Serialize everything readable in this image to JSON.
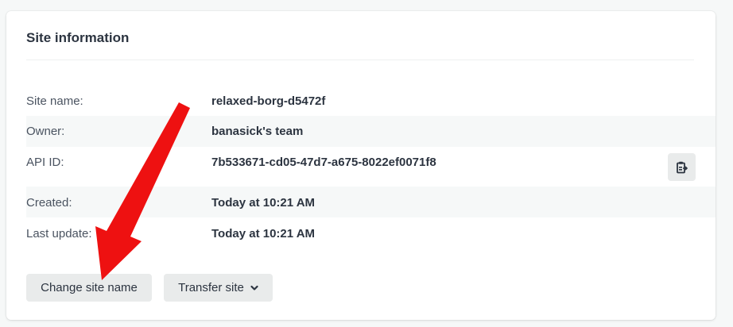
{
  "card": {
    "title": "Site information"
  },
  "rows": [
    {
      "label": "Site name:",
      "value": "relaxed-borg-d5472f"
    },
    {
      "label": "Owner:",
      "value": "banasick's team"
    },
    {
      "label": "API ID:",
      "value": "7b533671-cd05-47d7-a675-8022ef0071f8"
    },
    {
      "label": "Created:",
      "value": "Today at 10:21 AM"
    },
    {
      "label": "Last update:",
      "value": "Today at 10:21 AM"
    }
  ],
  "buttons": {
    "change_site_name": "Change site name",
    "transfer_site": "Transfer site"
  },
  "icons": {
    "copy": "clipboard-copy-icon",
    "dropdown": "chevron-down-icon",
    "annotation": "red-arrow"
  },
  "colors": {
    "arrow": "#ee1111",
    "button_bg": "#e9ebeb",
    "alt_row_bg": "#f6f8f8"
  }
}
